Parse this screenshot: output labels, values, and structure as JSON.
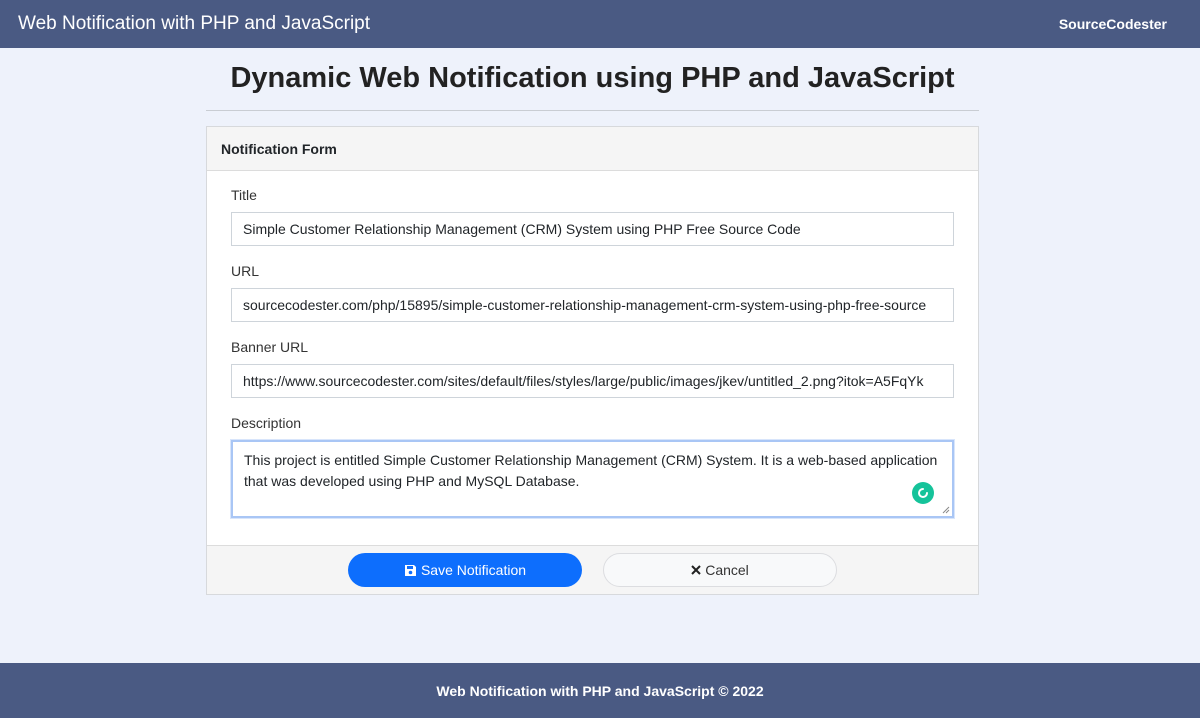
{
  "navbar": {
    "brand": "Web Notification with PHP and JavaScript",
    "right_text": "SourceCodester"
  },
  "page": {
    "title": "Dynamic Web Notification using PHP and JavaScript"
  },
  "form": {
    "header": "Notification Form",
    "title_label": "Title",
    "title_value": "Simple Customer Relationship Management (CRM) System using PHP Free Source Code",
    "url_label": "URL",
    "url_value": "sourcecodester.com/php/15895/simple-customer-relationship-management-crm-system-using-php-free-source",
    "banner_label": "Banner URL",
    "banner_value": "https://www.sourcecodester.com/sites/default/files/styles/large/public/images/jkev/untitled_2.png?itok=A5FqYk",
    "description_label": "Description",
    "description_value": "This project is entitled Simple Customer Relationship Management (CRM) System. It is a web-based application that was developed using PHP and MySQL Database.",
    "save_label": "Save Notification",
    "cancel_label": "Cancel"
  },
  "footer": {
    "text": "Web Notification with PHP and JavaScript © 2022"
  },
  "colors": {
    "navbar": "#4a5a83",
    "primary": "#0d6efd",
    "grammarly": "#15c39a"
  },
  "icons": {
    "save": "floppy-disk-icon",
    "cancel": "x-mark-icon",
    "assistant": "grammarly-icon"
  }
}
